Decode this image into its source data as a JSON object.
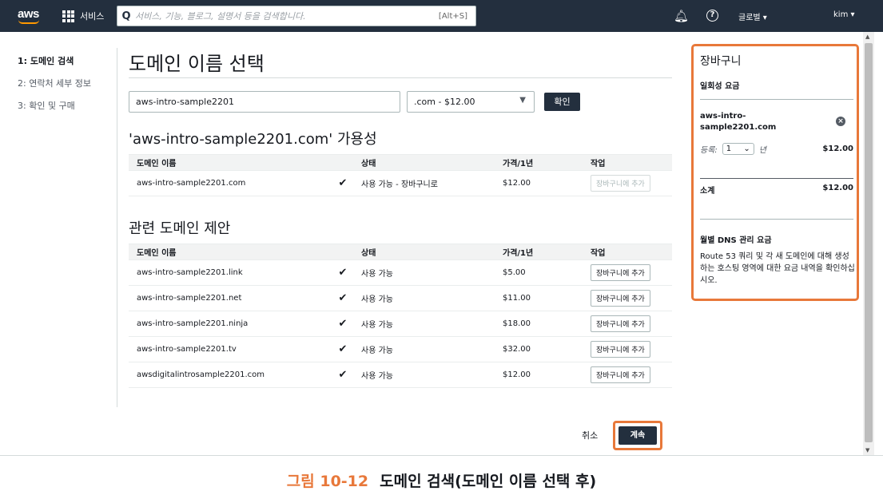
{
  "nav": {
    "logo": "aws",
    "services_label": "서비스",
    "search_placeholder": "서비스, 기능, 블로그, 설명서 등을 검색합니다.",
    "search_shortcut": "[Alt+S]",
    "region_label": "글로벌 ▾",
    "user_label": "kim ▾"
  },
  "steps": [
    {
      "label": "1: 도메인 검색",
      "active": true
    },
    {
      "label": "2: 연락처 세부 정보",
      "active": false
    },
    {
      "label": "3: 확인 및 구매",
      "active": false
    }
  ],
  "main": {
    "title": "도메인 이름 선택",
    "domain_value": "aws-intro-sample2201",
    "tld_value": ".com - $12.00",
    "confirm_label": "확인",
    "availability_title": "'aws-intro-sample2201.com' 가용성",
    "related_title": "관련 도메인 제안",
    "columns": [
      "도메인 이름",
      "상태",
      "가격/1년",
      "작업"
    ],
    "availability_rows": [
      {
        "name": "aws-intro-sample2201.com",
        "status": "사용 가능 - 장바구니로",
        "price": "$12.00",
        "action": "장바구니에 추가",
        "disabled": true
      }
    ],
    "related_rows": [
      {
        "name": "aws-intro-sample2201.link",
        "status": "사용 가능",
        "price": "$5.00",
        "action": "장바구니에 추가"
      },
      {
        "name": "aws-intro-sample2201.net",
        "status": "사용 가능",
        "price": "$11.00",
        "action": "장바구니에 추가"
      },
      {
        "name": "aws-intro-sample2201.ninja",
        "status": "사용 가능",
        "price": "$18.00",
        "action": "장바구니에 추가"
      },
      {
        "name": "aws-intro-sample2201.tv",
        "status": "사용 가능",
        "price": "$32.00",
        "action": "장바구니에 추가"
      },
      {
        "name": "awsdigitalintrosample2201.com",
        "status": "사용 가능",
        "price": "$12.00",
        "action": "장바구니에 추가"
      }
    ],
    "cancel_label": "취소",
    "continue_label": "계속"
  },
  "cart": {
    "title": "장바구니",
    "one_time_label": "일회성 요금",
    "item_name": "aws-intro-sample2201.com",
    "register_label": "등록:",
    "register_years": "1",
    "year_unit": "년",
    "item_price": "$12.00",
    "subtotal_label": "소계",
    "subtotal_value": "$12.00",
    "dns_label": "월별 DNS 관리 요금",
    "dns_desc": "Route 53 쿼리 및 각 새 도메인에 대해 생성하는 호스팅 영역에 대한 요금 내역을 확인하십시오."
  },
  "caption": {
    "number": "그림 10-12",
    "text": "도메인 검색(도메인 이름 선택 후)"
  },
  "colors": {
    "nav_bg": "#232f3e",
    "highlight": "#e8783a",
    "accent": "#ff9900"
  }
}
